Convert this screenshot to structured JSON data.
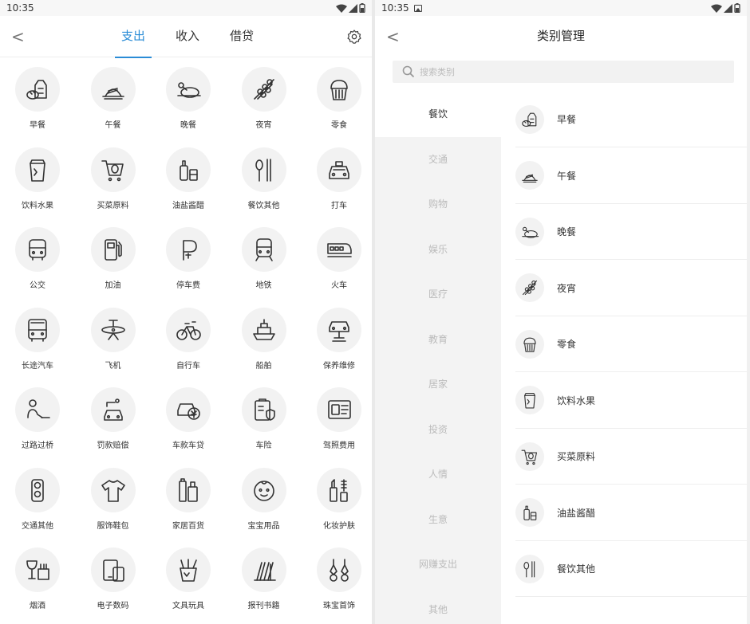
{
  "left": {
    "status_time": "10:35",
    "back": "<",
    "tabs": [
      {
        "label": "支出"
      },
      {
        "label": "收入"
      },
      {
        "label": "借贷"
      }
    ],
    "categories": [
      {
        "label": "早餐",
        "icon": "bread-milk-icon"
      },
      {
        "label": "午餐",
        "icon": "dish-icon"
      },
      {
        "label": "晚餐",
        "icon": "roast-chicken-icon"
      },
      {
        "label": "夜宵",
        "icon": "skewers-icon"
      },
      {
        "label": "零食",
        "icon": "cupcake-icon"
      },
      {
        "label": "饮料水果",
        "icon": "drink-cup-icon"
      },
      {
        "label": "买菜原料",
        "icon": "shopping-cart-icon"
      },
      {
        "label": "油盐酱醋",
        "icon": "bottles-icon"
      },
      {
        "label": "餐饮其他",
        "icon": "spoon-fork-icon"
      },
      {
        "label": "打车",
        "icon": "taxi-icon"
      },
      {
        "label": "公交",
        "icon": "bus-icon"
      },
      {
        "label": "加油",
        "icon": "fuel-pump-icon"
      },
      {
        "label": "停车费",
        "icon": "parking-icon"
      },
      {
        "label": "地铁",
        "icon": "metro-icon"
      },
      {
        "label": "火车",
        "icon": "train-icon"
      },
      {
        "label": "长途汽车",
        "icon": "coach-icon"
      },
      {
        "label": "飞机",
        "icon": "airplane-icon"
      },
      {
        "label": "自行车",
        "icon": "bicycle-icon"
      },
      {
        "label": "船舶",
        "icon": "ship-icon"
      },
      {
        "label": "保养维修",
        "icon": "car-lift-icon"
      },
      {
        "label": "过路过桥",
        "icon": "toll-icon"
      },
      {
        "label": "罚款赔偿",
        "icon": "fine-car-icon"
      },
      {
        "label": "车款车贷",
        "icon": "car-loan-icon"
      },
      {
        "label": "车险",
        "icon": "car-insurance-icon"
      },
      {
        "label": "驾照费用",
        "icon": "license-icon"
      },
      {
        "label": "交通其他",
        "icon": "traffic-light-icon"
      },
      {
        "label": "服饰鞋包",
        "icon": "tshirt-icon"
      },
      {
        "label": "家居百货",
        "icon": "household-icon"
      },
      {
        "label": "宝宝用品",
        "icon": "baby-icon"
      },
      {
        "label": "化妆护肤",
        "icon": "cosmetics-icon"
      },
      {
        "label": "烟酒",
        "icon": "wine-cigarette-icon"
      },
      {
        "label": "电子数码",
        "icon": "devices-icon"
      },
      {
        "label": "文具玩具",
        "icon": "pen-holder-icon"
      },
      {
        "label": "报刊书籍",
        "icon": "books-icon"
      },
      {
        "label": "珠宝首饰",
        "icon": "earrings-icon"
      }
    ]
  },
  "right": {
    "status_time": "10:35",
    "back": "<",
    "title": "类别管理",
    "search_placeholder": "搜索类别",
    "groups": [
      {
        "label": "餐饮"
      },
      {
        "label": "交通"
      },
      {
        "label": "购物"
      },
      {
        "label": "娱乐"
      },
      {
        "label": "医疗"
      },
      {
        "label": "教育"
      },
      {
        "label": "居家"
      },
      {
        "label": "投资"
      },
      {
        "label": "人情"
      },
      {
        "label": "生意"
      },
      {
        "label": "网赚支出"
      },
      {
        "label": "其他"
      }
    ],
    "items": [
      {
        "label": "早餐",
        "icon": "bread-milk-icon"
      },
      {
        "label": "午餐",
        "icon": "dish-icon"
      },
      {
        "label": "晚餐",
        "icon": "roast-chicken-icon"
      },
      {
        "label": "夜宵",
        "icon": "skewers-icon"
      },
      {
        "label": "零食",
        "icon": "cupcake-icon"
      },
      {
        "label": "饮料水果",
        "icon": "drink-cup-icon"
      },
      {
        "label": "买菜原料",
        "icon": "shopping-cart-icon"
      },
      {
        "label": "油盐酱醋",
        "icon": "bottles-icon"
      },
      {
        "label": "餐饮其他",
        "icon": "spoon-fork-icon"
      }
    ]
  },
  "colors": {
    "accent": "#2a8cd6",
    "icon": "#333333",
    "circle": "#f2f2f2"
  }
}
